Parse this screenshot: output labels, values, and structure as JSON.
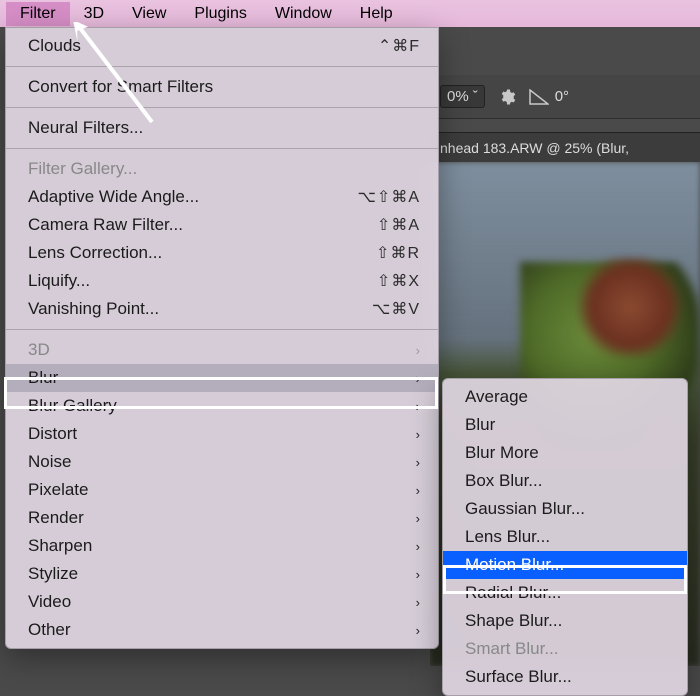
{
  "menubar": {
    "items": [
      {
        "label": "Filter",
        "highlight": true
      },
      {
        "label": "3D"
      },
      {
        "label": "View"
      },
      {
        "label": "Plugins"
      },
      {
        "label": "Window"
      },
      {
        "label": "Help"
      }
    ]
  },
  "toolbar": {
    "opacity_label": ":",
    "opacity_value": "0%",
    "angle_value": "0°"
  },
  "document": {
    "tab_title": "nhead 183.ARW @ 25% (Blur,"
  },
  "filter_menu": {
    "last_filter": {
      "label": "Clouds",
      "shortcut": "⌃⌘F"
    },
    "convert": "Convert for Smart Filters",
    "neural": "Neural Filters...",
    "group2": [
      {
        "label": "Filter Gallery...",
        "disabled": true
      },
      {
        "label": "Adaptive Wide Angle...",
        "shortcut": "⌥⇧⌘A"
      },
      {
        "label": "Camera Raw Filter...",
        "shortcut": "⇧⌘A"
      },
      {
        "label": "Lens Correction...",
        "shortcut": "⇧⌘R"
      },
      {
        "label": "Liquify...",
        "shortcut": "⇧⌘X"
      },
      {
        "label": "Vanishing Point...",
        "shortcut": "⌥⌘V"
      }
    ],
    "group3": [
      {
        "label": "3D",
        "submenu": true,
        "disabled": true
      },
      {
        "label": "Blur",
        "submenu": true,
        "hover": true
      },
      {
        "label": "Blur Gallery",
        "submenu": true
      },
      {
        "label": "Distort",
        "submenu": true
      },
      {
        "label": "Noise",
        "submenu": true
      },
      {
        "label": "Pixelate",
        "submenu": true
      },
      {
        "label": "Render",
        "submenu": true
      },
      {
        "label": "Sharpen",
        "submenu": true
      },
      {
        "label": "Stylize",
        "submenu": true
      },
      {
        "label": "Video",
        "submenu": true
      },
      {
        "label": "Other",
        "submenu": true
      }
    ]
  },
  "blur_submenu": {
    "items": [
      {
        "label": "Average"
      },
      {
        "label": "Blur"
      },
      {
        "label": "Blur More"
      },
      {
        "label": "Box Blur..."
      },
      {
        "label": "Gaussian Blur..."
      },
      {
        "label": "Lens Blur..."
      },
      {
        "label": "Motion Blur...",
        "selected": true
      },
      {
        "label": "Radial Blur..."
      },
      {
        "label": "Shape Blur..."
      },
      {
        "label": "Smart Blur...",
        "disabled": true
      },
      {
        "label": "Surface Blur..."
      }
    ]
  }
}
